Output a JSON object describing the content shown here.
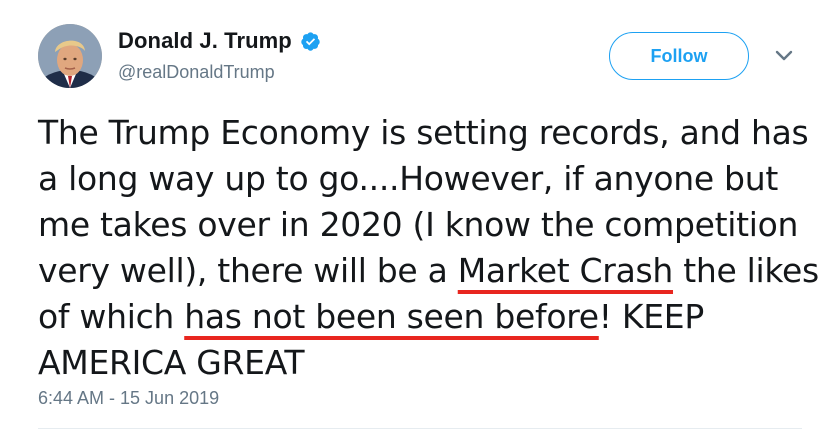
{
  "author": {
    "display_name": "Donald J. Trump",
    "handle": "@realDonaldTrump",
    "verified": true
  },
  "actions": {
    "follow_label": "Follow"
  },
  "tweet": {
    "segments": [
      {
        "text": "The Trump Economy is setting records, and has a long way up to go....However, if anyone but me takes over in 2020 (I know the competition very well), there will be a ",
        "underlined": false
      },
      {
        "text": "Market Crash",
        "underlined": true
      },
      {
        "text": " the likes of which ",
        "underlined": false
      },
      {
        "text": "has not been seen before",
        "underlined": true
      },
      {
        "text": "! KEEP AMERICA GREAT",
        "underlined": false
      }
    ],
    "timestamp": "6:44 AM - 15 Jun 2019"
  },
  "colors": {
    "accent": "#1da1f2",
    "underline": "#e8261f",
    "text": "#14171a",
    "secondary": "#657786"
  },
  "icons": {
    "verified": "verified-badge-icon",
    "caret": "chevron-down-icon",
    "avatar": "profile-photo"
  }
}
